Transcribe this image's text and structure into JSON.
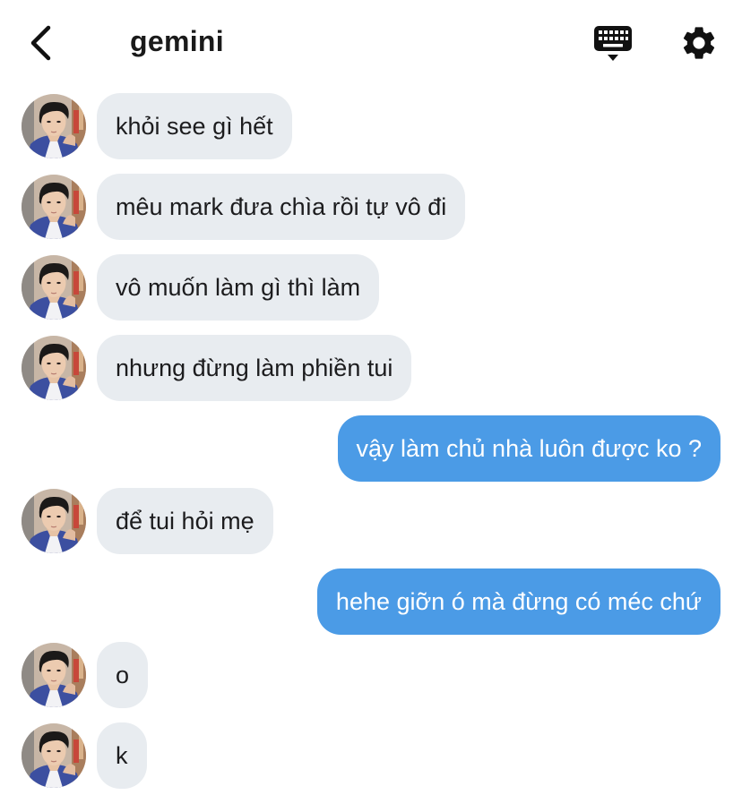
{
  "header": {
    "title": "gemini",
    "icons": {
      "back": "chevron-left-icon",
      "keyboard": "keyboard-icon",
      "settings": "gear-icon"
    }
  },
  "colors": {
    "incoming_bubble": "#e8ecf0",
    "outgoing_bubble": "#4b9be6",
    "outgoing_text": "#ffffff",
    "background": "#ffffff"
  },
  "messages": [
    {
      "sender": "them",
      "text": "khỏi see gì hết"
    },
    {
      "sender": "them",
      "text": "mêu mark đưa chìa rồi tự vô đi"
    },
    {
      "sender": "them",
      "text": " vô muốn làm gì thì làm"
    },
    {
      "sender": "them",
      "text": "nhưng đừng làm phiền tui"
    },
    {
      "sender": "me",
      "text": "vậy làm chủ nhà luôn được ko ?"
    },
    {
      "sender": "them",
      "text": "để tui hỏi mẹ"
    },
    {
      "sender": "me",
      "text": "hehe giỡn ó mà đừng có méc chứ"
    },
    {
      "sender": "them",
      "text": "o"
    },
    {
      "sender": "them",
      "text": "k"
    }
  ]
}
